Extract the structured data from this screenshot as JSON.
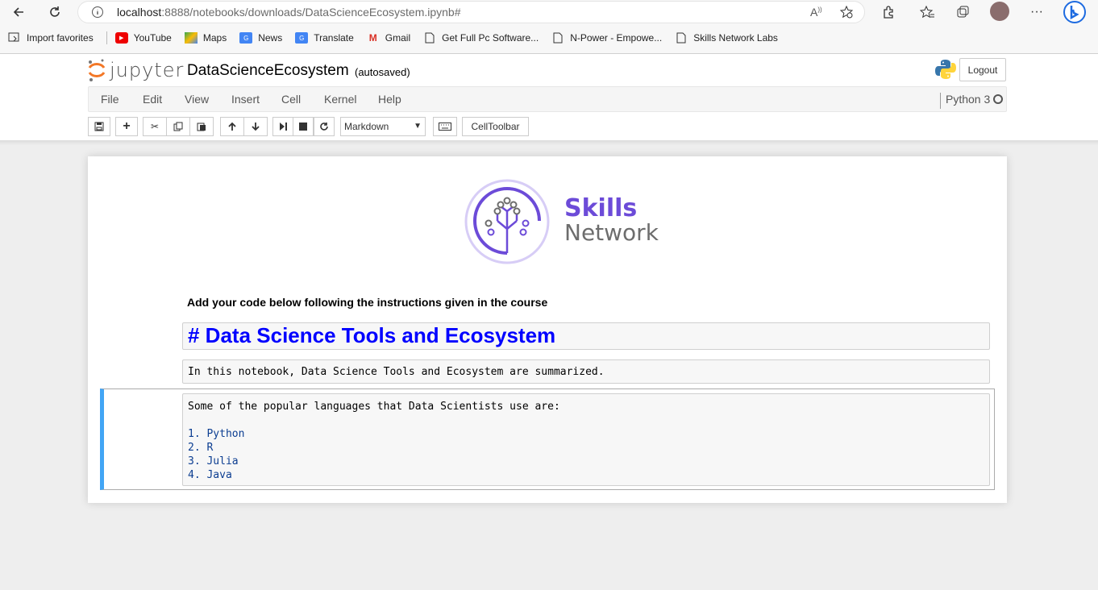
{
  "browser": {
    "url_host": "localhost",
    "url_path": ":8888/notebooks/downloads/DataScienceEcosystem.ipynb#",
    "icons": [
      "back-icon",
      "refresh-icon",
      "info-icon",
      "read-aloud-icon",
      "add-favorite-icon",
      "extensions-icon",
      "favorites-icon",
      "collections-icon",
      "profile-avatar",
      "more-icon",
      "bing-icon"
    ],
    "bookmarks": [
      {
        "label": "Import favorites",
        "icon": "import-icon"
      },
      {
        "label": "YouTube",
        "icon": "youtube-icon"
      },
      {
        "label": "Maps",
        "icon": "maps-icon"
      },
      {
        "label": "News",
        "icon": "news-icon"
      },
      {
        "label": "Translate",
        "icon": "translate-icon"
      },
      {
        "label": "Gmail",
        "icon": "gmail-icon"
      },
      {
        "label": "Get Full Pc Software...",
        "icon": "page-icon"
      },
      {
        "label": "N-Power - Empowe...",
        "icon": "page-icon"
      },
      {
        "label": "Skills Network Labs",
        "icon": "page-icon"
      }
    ]
  },
  "jupyter": {
    "logo_text": "jupyter",
    "notebook_title": "DataScienceEcosystem",
    "autosave_status": "(autosaved)",
    "logout_label": "Logout",
    "menu": [
      "File",
      "Edit",
      "View",
      "Insert",
      "Cell",
      "Kernel",
      "Help"
    ],
    "kernel_name": "Python 3",
    "cell_type": "Markdown",
    "celltoolbar_label": "CellToolbar",
    "accent_color": "#42a5f5"
  },
  "notebook": {
    "logo_line1": "Skills",
    "logo_line2": "Network",
    "instructions": "Add your code below following the instructions given in the course",
    "heading_cell": "# Data Science Tools and Ecosystem",
    "intro_cell": "In this notebook, Data Science Tools and Ecosystem are summarized.",
    "languages_intro": "Some of the popular languages that Data Scientists use are:",
    "languages": [
      "1. Python",
      "2. R",
      "3. Julia",
      "4. Java"
    ]
  }
}
